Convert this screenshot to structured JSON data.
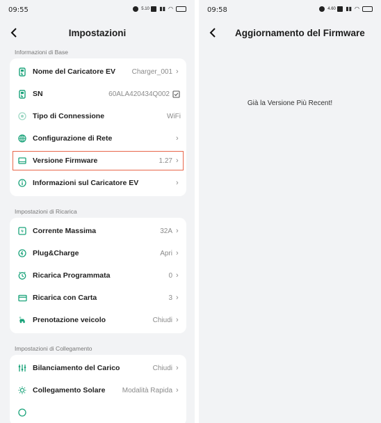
{
  "left": {
    "status": {
      "time": "09:55",
      "speed": "5.10"
    },
    "title": "Impostazioni",
    "sections": [
      {
        "label": "Informazioni di Base",
        "rows": [
          {
            "label": "Nome del Caricatore EV",
            "value": "Charger_001",
            "chev": "›",
            "icon": "charger-icon"
          },
          {
            "label": "SN",
            "value": "60ALA420434Q002",
            "chev": "",
            "icon": "charger-icon",
            "copy": true
          },
          {
            "label": "Tipo di Connessione",
            "value": "WiFi",
            "chev": "",
            "icon": "connection-icon",
            "muted": true
          },
          {
            "label": "Configurazione di Rete",
            "value": "",
            "chev": "›",
            "icon": "network-icon"
          },
          {
            "label": "Versione Firmware",
            "value": "1.27",
            "chev": "›",
            "icon": "firmware-icon",
            "highlight": true
          },
          {
            "label": "Informazioni sul Caricatore EV",
            "value": "",
            "chev": "›",
            "icon": "info-icon"
          }
        ]
      },
      {
        "label": "Impostazioni di Ricarica",
        "rows": [
          {
            "label": "Corrente Massima",
            "value": "32A",
            "chev": "›",
            "icon": "current-icon"
          },
          {
            "label": "Plug&Charge",
            "value": "Apri",
            "chev": "›",
            "icon": "plug-icon"
          },
          {
            "label": "Ricarica Programmata",
            "value": "0",
            "chev": "›",
            "icon": "clock-icon"
          },
          {
            "label": "Ricarica con Carta",
            "value": "3",
            "chev": "›",
            "icon": "card-icon"
          },
          {
            "label": "Prenotazione veicolo",
            "value": "Chiudi",
            "chev": "›",
            "icon": "car-icon"
          }
        ]
      },
      {
        "label": "Impostazioni di Collegamento",
        "rows": [
          {
            "label": "Bilanciamento del Carico",
            "value": "Chiudi",
            "chev": "›",
            "icon": "balance-icon"
          },
          {
            "label": "Collegamento Solare",
            "value": "Modalità Rapida",
            "chev": "›",
            "icon": "solar-icon"
          },
          {
            "label": "",
            "value": "",
            "chev": "",
            "icon": "partial-icon"
          }
        ]
      }
    ]
  },
  "right": {
    "status": {
      "time": "09:58",
      "speed": "4.60"
    },
    "title": "Aggiornamento del Firmware",
    "message": "Già la Versione Più Recent!"
  },
  "colors": {
    "accent": "#1aa37a",
    "highlight_border": "#e8664a",
    "background": "#f2f3f5"
  }
}
